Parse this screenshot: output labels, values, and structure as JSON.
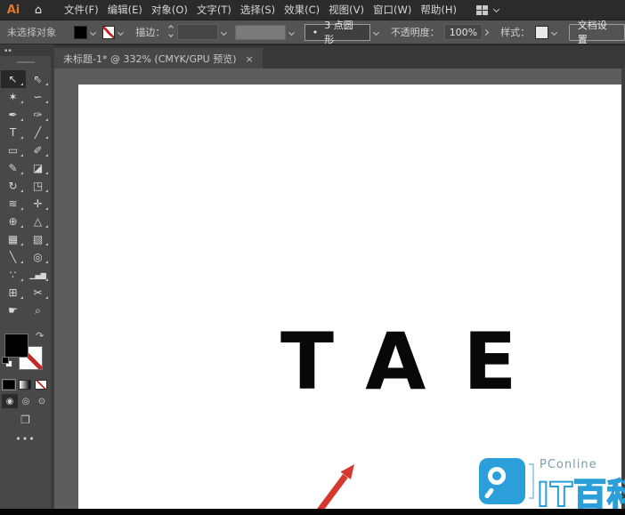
{
  "app_bar": {
    "logo": "Ai",
    "home_glyph": "⌂",
    "menus": [
      {
        "label": "文件(F)"
      },
      {
        "label": "编辑(E)"
      },
      {
        "label": "对象(O)"
      },
      {
        "label": "文字(T)"
      },
      {
        "label": "选择(S)"
      },
      {
        "label": "效果(C)"
      },
      {
        "label": "视图(V)"
      },
      {
        "label": "窗口(W)"
      },
      {
        "label": "帮助(H)"
      }
    ]
  },
  "control_bar": {
    "status": "未选择对象",
    "stroke_label": "描边：",
    "brush_bullet": "•",
    "brush_name": "3 点圆形",
    "opacity_label": "不透明度：",
    "opacity_value": "100%",
    "style_label": "样式：",
    "doc_setup_label": "文档设置"
  },
  "document_tab": {
    "title": "未标题-1* @ 332% (CMYK/GPU 预览)",
    "close_glyph": "×"
  },
  "toolbar": {
    "collapse_glyph": "▪▪",
    "tools": [
      {
        "name": "selection",
        "glyph": "↖",
        "selected": true
      },
      {
        "name": "direct-selection",
        "glyph": "⇖"
      },
      {
        "name": "magic-wand",
        "glyph": "✶"
      },
      {
        "name": "lasso",
        "glyph": "∽"
      },
      {
        "name": "pen",
        "glyph": "✒"
      },
      {
        "name": "curvature",
        "glyph": "✑"
      },
      {
        "name": "type",
        "glyph": "T"
      },
      {
        "name": "line-segment",
        "glyph": "╱"
      },
      {
        "name": "rectangle",
        "glyph": "▭"
      },
      {
        "name": "paintbrush",
        "glyph": "✐"
      },
      {
        "name": "shaper",
        "glyph": "✎"
      },
      {
        "name": "eraser",
        "glyph": "◪"
      },
      {
        "name": "rotate",
        "glyph": "↻"
      },
      {
        "name": "scale",
        "glyph": "◳"
      },
      {
        "name": "width",
        "glyph": "≋"
      },
      {
        "name": "free-transform",
        "glyph": "✛"
      },
      {
        "name": "shape-builder",
        "glyph": "⊕"
      },
      {
        "name": "perspective-grid",
        "glyph": "△"
      },
      {
        "name": "mesh",
        "glyph": "▦"
      },
      {
        "name": "gradient",
        "glyph": "▧"
      },
      {
        "name": "eyedropper",
        "glyph": "╲"
      },
      {
        "name": "blend",
        "glyph": "◎"
      },
      {
        "name": "symbol-sprayer",
        "glyph": "∵"
      },
      {
        "name": "column-graph",
        "glyph": "▁▄▆"
      },
      {
        "name": "artboard",
        "glyph": "⊞"
      },
      {
        "name": "slice",
        "glyph": "✂"
      },
      {
        "name": "hand",
        "glyph": "☛"
      },
      {
        "name": "zoom",
        "glyph": "⌕"
      }
    ],
    "swap_glyph": "↷",
    "drawing_modes": [
      {
        "name": "draw-normal",
        "glyph": "◉",
        "selected": true
      },
      {
        "name": "draw-behind",
        "glyph": "◎"
      },
      {
        "name": "draw-inside",
        "glyph": "⊙"
      }
    ],
    "screen_mode_glyph": "❐",
    "more_glyph": "•••"
  },
  "canvas": {
    "artboard_text": "TAE"
  },
  "watermark": {
    "brand": "PConline",
    "title": "IT百科"
  },
  "colors": {
    "logo_orange": "#e0762b",
    "annotation_red": "#d6382f",
    "watermark_blue": "#2b9fd9",
    "artboard_white": "#ffffff",
    "ui_dark": "#2b2b2b"
  }
}
